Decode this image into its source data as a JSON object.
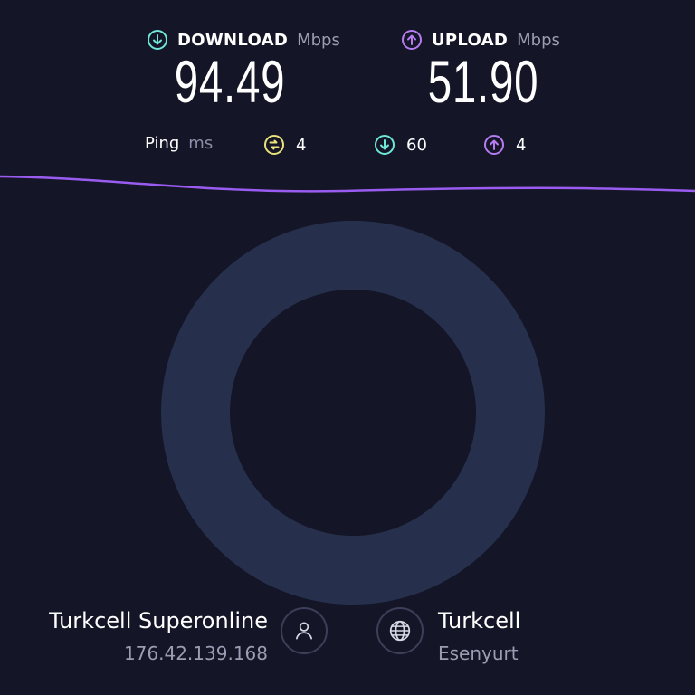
{
  "download": {
    "label": "DOWNLOAD",
    "unit": "Mbps",
    "value": "94.49",
    "icon": "arrow-down-circle-icon",
    "color": "#6ee7d8"
  },
  "upload": {
    "label": "UPLOAD",
    "unit": "Mbps",
    "value": "51.90",
    "icon": "arrow-up-circle-icon",
    "color": "#b57cf0"
  },
  "ping": {
    "label": "Ping",
    "unit": "ms",
    "idle": {
      "icon": "latency-icon",
      "value": "4",
      "color": "#e8e27a"
    },
    "download": {
      "icon": "arrow-down-circle-icon",
      "value": "60",
      "color": "#6ee7d8"
    },
    "upload": {
      "icon": "arrow-up-circle-icon",
      "value": "4",
      "color": "#b57cf0"
    }
  },
  "provider": {
    "name": "Turkcell Superonline",
    "ip": "176.42.139.168",
    "icon": "user-icon"
  },
  "server": {
    "name": "Turkcell",
    "location": "Esenyurt",
    "icon": "globe-icon"
  },
  "colors": {
    "background": "#141526",
    "ring": "#26304d",
    "graph_line": "#9a5cf0",
    "muted": "#9b9db3"
  }
}
